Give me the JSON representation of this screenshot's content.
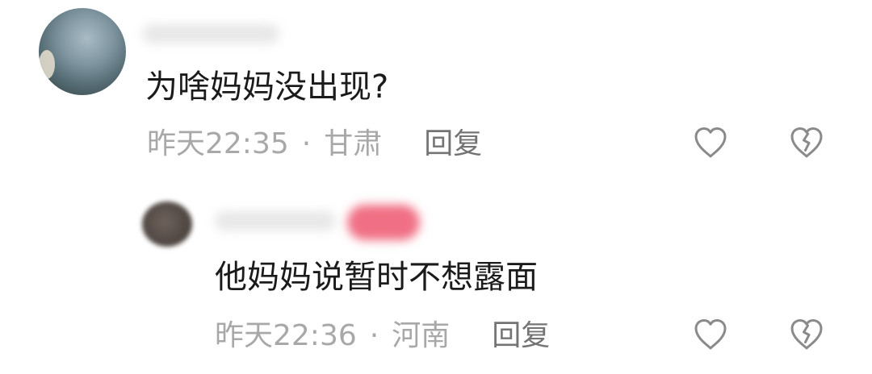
{
  "comments": {
    "main": {
      "text": "为啥妈妈没出现?",
      "time": "昨天22:35",
      "separator": "·",
      "location": "甘肃",
      "reply_label": "回复",
      "icons": {
        "avatar": "avatar-icon",
        "like": "heart-icon",
        "dislike": "broken-heart-icon"
      }
    },
    "reply": {
      "text": "他妈妈说暂时不想露面",
      "time": "昨天22:36",
      "separator": "·",
      "location": "河南",
      "reply_label": "回复",
      "icons": {
        "avatar": "avatar-icon",
        "like": "heart-icon",
        "dislike": "broken-heart-icon"
      }
    }
  },
  "colors": {
    "text_primary": "#1b1b1b",
    "text_secondary": "#a8a8a8",
    "reply_button": "#747474",
    "icon_stroke": "#8a8a8a",
    "badge_blur": "#f06f84"
  }
}
